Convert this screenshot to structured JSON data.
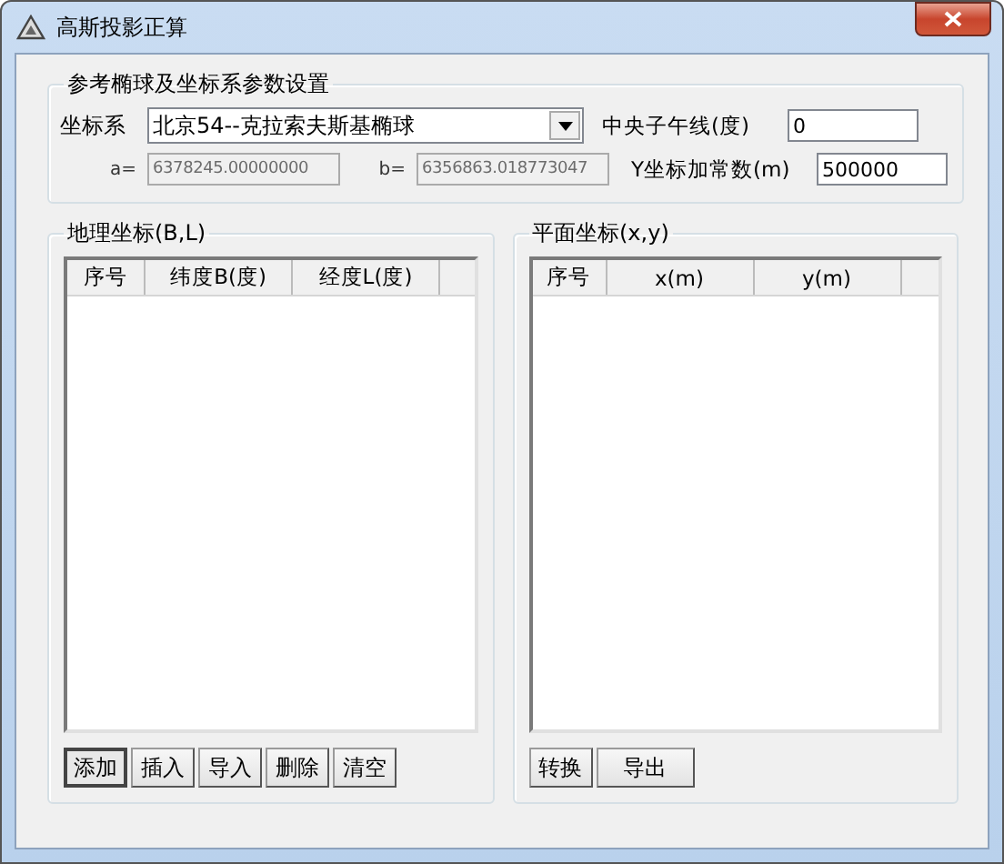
{
  "window": {
    "title": "高斯投影正算"
  },
  "params": {
    "title": "参考椭球及坐标系参数设置",
    "coord_label": "坐标系",
    "coord_value": "北京54--克拉索夫斯基椭球",
    "meridian_label": "中央子午线(度)",
    "meridian_value": "0",
    "a_label": "a=",
    "a_value": "6378245.00000000",
    "a_disabled": true,
    "b_label": "b=",
    "b_value": "6356863.018773047",
    "b_disabled": true,
    "offset_label": "Y坐标加常数(m)",
    "offset_value": "500000"
  },
  "geo": {
    "title": "地理坐标(B,L)",
    "columns": [
      "序号",
      "纬度B(度)",
      "经度L(度)"
    ],
    "buttons": [
      {
        "label": "添加",
        "default": true
      },
      {
        "label": "插入",
        "default": false
      },
      {
        "label": "导入",
        "default": false
      },
      {
        "label": "删除",
        "default": false
      },
      {
        "label": "清空",
        "default": false
      }
    ]
  },
  "plane": {
    "title": "平面坐标(x,y)",
    "columns": [
      "序号",
      "x(m)",
      "y(m)"
    ],
    "buttons": [
      {
        "label": "转换",
        "default": false
      },
      {
        "label": "导出",
        "default": false
      }
    ]
  }
}
